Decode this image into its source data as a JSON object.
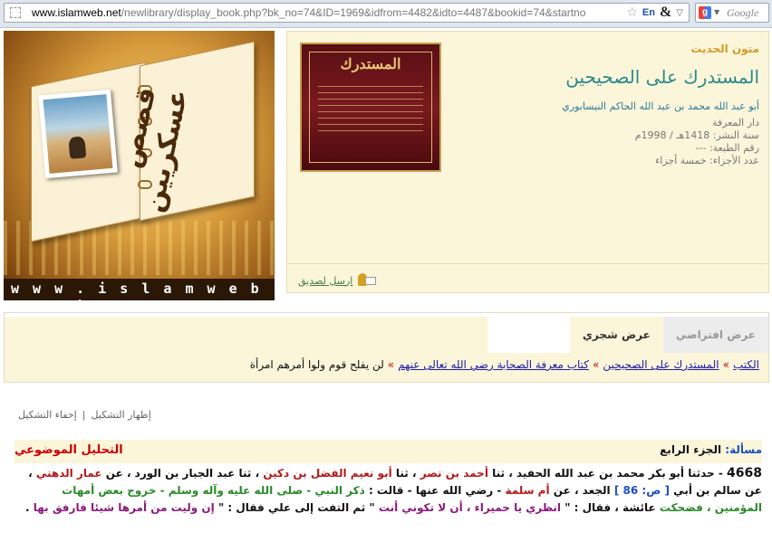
{
  "browser": {
    "url_host": "www.islamweb.net",
    "url_path": "/newlibrary/display_book.php?bk_no=74&ID=1969&idfrom=4482&idto=4487&bookid=74&startno",
    "translate_label": "En",
    "amp_label": "&",
    "search_placeholder": "Google"
  },
  "banner": {
    "title_line1": "قصص",
    "title_line2": "عسكريين",
    "site": "w w w . i s l a m w e b . n e t"
  },
  "book": {
    "category": "متون الحديث",
    "title": "المستدرك على الصحيحين",
    "author": "أبو عبد الله محمد بن عبد الله الحاكم النيسابوري",
    "publisher": "دار المعرفة",
    "year": "سنة النشر: 1418هـ / 1998م",
    "edition": "رقم الطبعة: ---",
    "parts": "عدد الأجزاء: خمسة أجزاء",
    "cover_title": "المستدرك",
    "send_friend": "ارسل لصديق"
  },
  "tabs": [
    {
      "label": "عرض افتراضي"
    },
    {
      "label": "عرض شجري"
    }
  ],
  "breadcrumb": {
    "items": [
      "الكتب",
      "المستدرك على الصحيحين",
      "كتاب معرفة الصحابة رضي الله تعالى عنهم"
    ],
    "separator": "»",
    "current": "لن يفلح قوم ولوا أمرهم امرأة"
  },
  "shakl": {
    "show": "إظهار التشكيل",
    "sep": "|",
    "hide": "إخفاء التشكيل"
  },
  "hadith": {
    "issue_label": "مسألة:",
    "part_label": "الجزء الرابع",
    "analysis_label": "التحليل الموضوعي",
    "number": "4668",
    "t1": " - حدثنا أبو بكر محمد بن عبد الله الحفيد ، ثنا ",
    "n1": "أحمد بن نصر",
    "t2": " ، ثنا ",
    "n2": "أبو نعيم الفضل بن دكين",
    "t3": " ، ثنا عبد الجبار بن الورد ، عن ",
    "n3": "عمار الدهني",
    "t4": " ، عن سالم بن أبي ",
    "page_ref": "[ ص: 86 ]",
    "t5": " الجعد ، عن ",
    "n4": "أم سلمة",
    "t6": " - رضي الله عنها - قالت : ",
    "q1": "ذكر النبي - صلى الله عليه وآله وسلم - خروج بعض أمهات المؤمنين ، فضحكت",
    "t7": " عائشة ، فقال : \" ",
    "s1": "انظري يا حميراء ، أن لا تكوني أنت",
    "t8": " \" ثم التفت إلى علي فقال : \" ",
    "s2": "إن وليت من أمرها شيئا فارفق بها",
    "t9": " ."
  }
}
